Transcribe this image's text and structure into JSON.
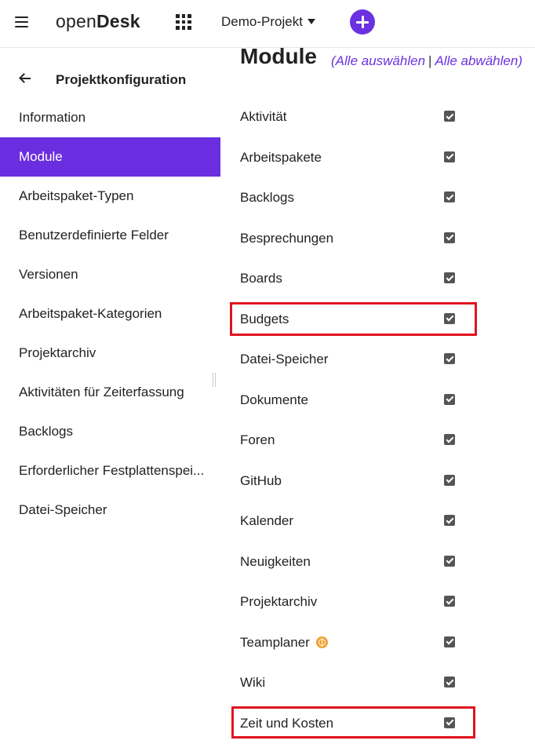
{
  "app": {
    "logo_light": "open",
    "logo_bold": "Desk"
  },
  "header": {
    "project": "Demo-Projekt"
  },
  "sidebar": {
    "title": "Projektkonfiguration",
    "items": [
      {
        "label": "Information",
        "active": false
      },
      {
        "label": "Module",
        "active": true
      },
      {
        "label": "Arbeitspaket-Typen",
        "active": false
      },
      {
        "label": "Benutzerdefinierte Felder",
        "active": false
      },
      {
        "label": "Versionen",
        "active": false
      },
      {
        "label": "Arbeitspaket-Kategorien",
        "active": false
      },
      {
        "label": "Projektarchiv",
        "active": false
      },
      {
        "label": "Aktivitäten für Zeiterfassung",
        "active": false
      },
      {
        "label": "Backlogs",
        "active": false
      },
      {
        "label": "Erforderlicher Festplattenspei...",
        "active": false
      },
      {
        "label": "Datei-Speicher",
        "active": false
      }
    ]
  },
  "main": {
    "title": "Module",
    "open_paren": "(",
    "select_all": "Alle auswählen",
    "separator": "|",
    "deselect_all": "Alle abwählen",
    "close_paren": ")",
    "modules": [
      {
        "label": "Aktivität",
        "checked": true
      },
      {
        "label": "Arbeitspakete",
        "checked": true
      },
      {
        "label": "Backlogs",
        "checked": true
      },
      {
        "label": "Besprechungen",
        "checked": true
      },
      {
        "label": "Boards",
        "checked": true
      },
      {
        "label": "Budgets",
        "checked": true
      },
      {
        "label": "Datei-Speicher",
        "checked": true
      },
      {
        "label": "Dokumente",
        "checked": true
      },
      {
        "label": "Foren",
        "checked": true
      },
      {
        "label": "GitHub",
        "checked": true
      },
      {
        "label": "Kalender",
        "checked": true
      },
      {
        "label": "Neuigkeiten",
        "checked": true
      },
      {
        "label": "Projektarchiv",
        "checked": true
      },
      {
        "label": "Teamplaner",
        "checked": true,
        "icon": "enterprise-globe-icon"
      },
      {
        "label": "Wiki",
        "checked": true
      },
      {
        "label": "Zeit und Kosten",
        "checked": true
      }
    ]
  },
  "colors": {
    "accent": "#6a2ee0",
    "highlight": "#e0141e"
  }
}
